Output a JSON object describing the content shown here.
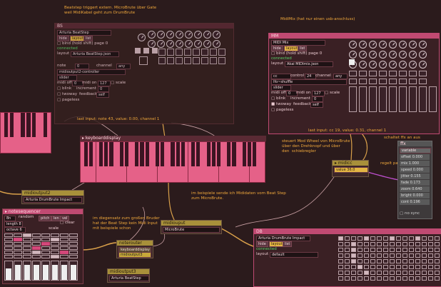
{
  "notes": {
    "beatstep": "Beatstep triggert extern. MicroBrute über Gate\nweil MidiKabel geht zum DrumBrute",
    "midimix": "MidiMix (hat nur einen usb-anschluss)",
    "last_bs": "last input: note 43, value: 0.00, channel 1",
    "last_mm": "last input: cc 19, value: 0.31, channel 1",
    "mod_wheel": "steuert Mod Wheel von MicroBrute\nüber den Drehknopf und über\nden  schiebregler",
    "schalte": "schaltet ffx an aus",
    "regelt": "regelt parameter von ffx",
    "beispiel1": "im beispiele sende ich Mididaten vom Beat Step\nzum MicroBrute.",
    "beispiel2": "im diegensatz zum großen Bruder\nhat der Beat Step kein Midi Input\nmit beispiele schon"
  },
  "bs": {
    "title": "BS",
    "device": "Arturia BeatStep",
    "hide": "hide",
    "layout_btn": "layout",
    "list_btn": "list",
    "bind_label": "bind (hold shift)",
    "page_label": "page",
    "page_value": "0",
    "connected": "connected",
    "layout_label": "layout",
    "layout_value": "Arturia BeatStep.json",
    "note_label": "note",
    "note_value": "0",
    "channel_label": "channel",
    "channel_value": "any",
    "mapping": "midioutput2-controller",
    "slider_label": "slider",
    "midi_off_label": "midi off",
    "midi_on_label": "midi on",
    "midi_off_value": "0",
    "midi_on_value": "127",
    "scale_label": "scale",
    "blink_label": "blink",
    "increment_label": "increment",
    "increment_value": "0",
    "twoway_label": "twoway",
    "feedback_label": "feedback",
    "feedback_value": "self",
    "pageless_label": "pageless"
  },
  "mm": {
    "title": "MM",
    "device": "MIDI Mix",
    "hide": "hide",
    "layout_btn": "layout",
    "list_btn": "list",
    "bind_label": "bind (hold shift)",
    "page_label": "page",
    "page_value": "0",
    "connected": "connected",
    "layout_label": "layout",
    "layout_value": "Akai MIDImix.json",
    "cc_value": "cc",
    "control_label": "control",
    "control_value": "24",
    "channel_label": "channel",
    "channel_value": "any",
    "mapping": "lfo~shuffle",
    "slider_label": "slider",
    "midi_off_label": "midi off",
    "midi_on_label": "midi on",
    "midi_off_value": "0",
    "midi_on_value": "127",
    "scale_label": "scale",
    "blink_label": "blink",
    "increment_label": "increment",
    "increment_value": "0",
    "twoway_label": "twoway",
    "feedback_label": "feedback",
    "feedback_value": "self",
    "pageless_label": "pageless"
  },
  "kbd": {
    "title": "keyboarddisplay"
  },
  "midicc": {
    "title": "midicc",
    "value_label": "value",
    "value": "36.0"
  },
  "ffx": {
    "title": "ffx",
    "variable": "variable",
    "params": [
      "offset 0.000",
      "mix 1.000",
      "speed 0.000",
      "jitter 0.155",
      "fade 0.173",
      "zoom 0.640",
      "bright 0.000",
      "cont 0.196"
    ],
    "no_sync": "no sync"
  },
  "midioutput2": {
    "title": "midioutput2",
    "device": "Arturia DrumBrute Impact"
  },
  "midiouput": {
    "title": "midiouput",
    "device": "MicroBrute"
  },
  "noterouter": {
    "title": "noterouter",
    "in1": "keyboarddisplay",
    "in2": "midioutput3"
  },
  "midioutput3": {
    "title": "midioutput3",
    "device": "Arturia BeatStep"
  },
  "notesequencer": {
    "title": "notesequencer",
    "mode": "8n",
    "random_label": "random",
    "pitch_label": "pitch",
    "len_label": "len",
    "vel_label": "vel",
    "length_label": "length",
    "length_value": "8",
    "clear_label": "clear",
    "octave_label": "octave",
    "octave_value": "6",
    "scale_label": "scale"
  },
  "db": {
    "title": "DB",
    "device": "Arturia DrumBrute Impact",
    "hide": "hide",
    "layout_btn": "layout",
    "list_btn": "list",
    "connected": "connected",
    "layout_label": "layout",
    "layout_value": "default"
  },
  "colors": {
    "bg": "#2b1b1c",
    "accent": "#e3b544",
    "pink": "#d4477a",
    "green": "#59d56a"
  }
}
